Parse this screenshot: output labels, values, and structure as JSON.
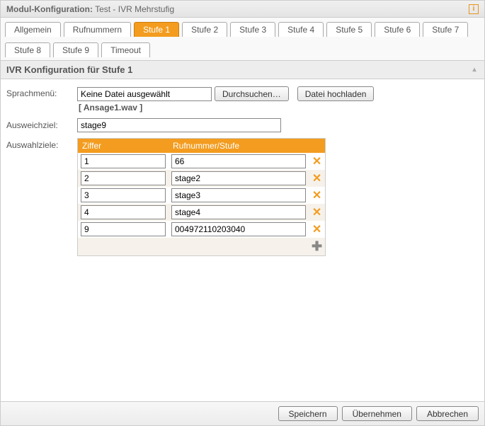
{
  "header": {
    "title_prefix": "Modul-Konfiguration:",
    "title_value": "Test - IVR Mehrstufig",
    "info_icon": "i"
  },
  "tabs": [
    {
      "label": "Allgemein",
      "active": false
    },
    {
      "label": "Rufnummern",
      "active": false
    },
    {
      "label": "Stufe 1",
      "active": true
    },
    {
      "label": "Stufe 2",
      "active": false
    },
    {
      "label": "Stufe 3",
      "active": false
    },
    {
      "label": "Stufe 4",
      "active": false
    },
    {
      "label": "Stufe 5",
      "active": false
    },
    {
      "label": "Stufe 6",
      "active": false
    },
    {
      "label": "Stufe 7",
      "active": false
    },
    {
      "label": "Stufe 8",
      "active": false
    },
    {
      "label": "Stufe 9",
      "active": false
    },
    {
      "label": "Timeout",
      "active": false
    }
  ],
  "section": {
    "title": "IVR Konfiguration für Stufe 1"
  },
  "sprachmenu": {
    "label": "Sprachmenü:",
    "file_value": "Keine Datei ausgewählt",
    "browse_label": "Durchsuchen…",
    "upload_label": "Datei hochladen",
    "file_hint": "[ Ansage1.wav ]"
  },
  "ausweichziel": {
    "label": "Ausweichziel:",
    "value": "stage9"
  },
  "auswahlziele": {
    "label": "Auswahlziele:",
    "col_ziffer": "Ziffer",
    "col_rufnummer": "Rufnummer/Stufe",
    "rows": [
      {
        "ziffer": "1",
        "rufnummer": "66"
      },
      {
        "ziffer": "2",
        "rufnummer": "stage2"
      },
      {
        "ziffer": "3",
        "rufnummer": "stage3"
      },
      {
        "ziffer": "4",
        "rufnummer": "stage4"
      },
      {
        "ziffer": "9",
        "rufnummer": "004972110203040"
      }
    ],
    "delete_icon": "✕",
    "add_icon": "✚"
  },
  "footer": {
    "save": "Speichern",
    "apply": "Übernehmen",
    "cancel": "Abbrechen"
  }
}
